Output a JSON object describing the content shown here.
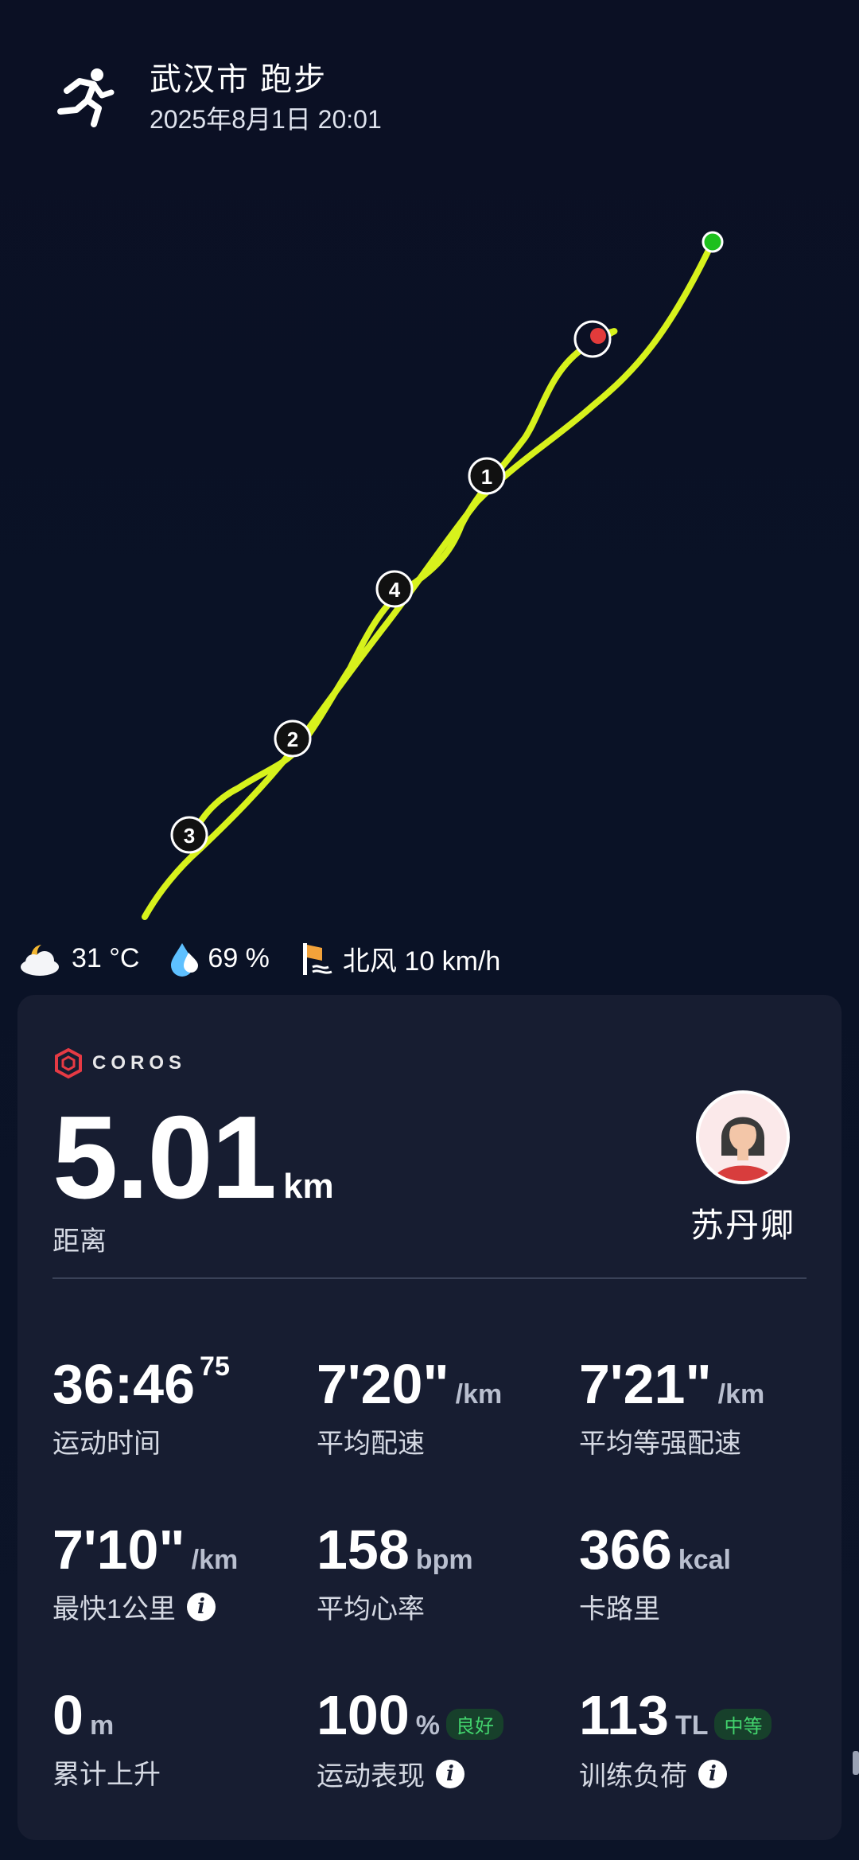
{
  "header": {
    "title": "武汉市 跑步",
    "datetime": "2025年8月1日 20:01",
    "icon": "running-person-icon"
  },
  "map": {
    "route_color": "#d7f21c",
    "start_color": "#1ec01e",
    "end_color": "#e23b3b",
    "markers": [
      "1",
      "2",
      "3",
      "4"
    ]
  },
  "weather": {
    "temperature": "31 °C",
    "humidity": "69 %",
    "wind": "北风 10 km/h"
  },
  "card": {
    "brand": "COROS",
    "distance": {
      "value": "5.01",
      "unit": "km",
      "label": "距离"
    },
    "user": {
      "name": "苏丹卿"
    },
    "stats": {
      "duration": {
        "value": "36:46",
        "sup": "75",
        "label": "运动时间"
      },
      "avg_pace": {
        "value": "7'20\"",
        "unit": "/km",
        "label": "平均配速"
      },
      "avg_grade_pace": {
        "value": "7'21\"",
        "unit": "/km",
        "label": "平均等强配速"
      },
      "fastest_km": {
        "value": "7'10\"",
        "unit": "/km",
        "label": "最快1公里"
      },
      "avg_hr": {
        "value": "158",
        "unit": "bpm",
        "label": "平均心率"
      },
      "calories": {
        "value": "366",
        "unit": "kcal",
        "label": "卡路里"
      },
      "elevation": {
        "value": "0",
        "unit": "m",
        "label": "累计上升"
      },
      "performance": {
        "value": "100",
        "unit": "%",
        "badge": "良好",
        "label": "运动表现"
      },
      "training_load": {
        "value": "113",
        "unit": "TL",
        "badge": "中等",
        "label": "训练负荷"
      }
    }
  }
}
